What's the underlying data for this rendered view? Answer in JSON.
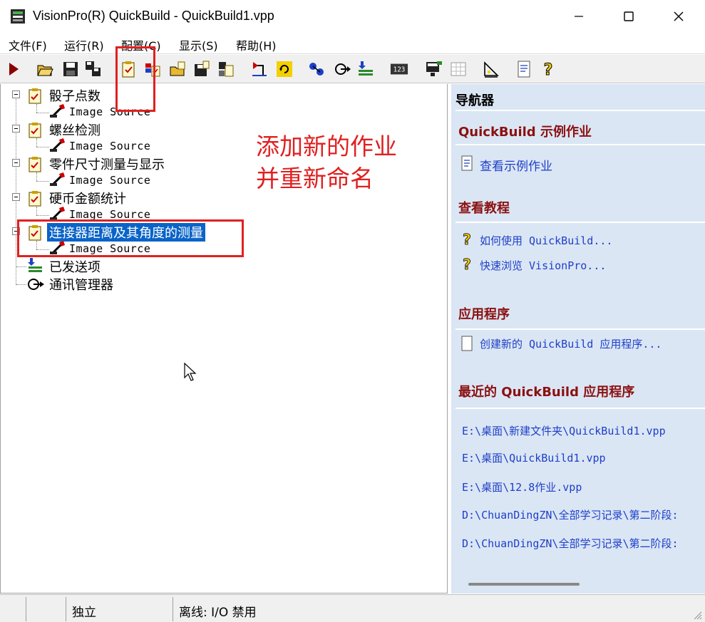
{
  "window": {
    "title": "VisionPro(R) QuickBuild - QuickBuild1.vpp"
  },
  "menu": {
    "items": [
      "文件(F)",
      "运行(R)",
      "配置(C)",
      "显示(S)",
      "帮助(H)"
    ]
  },
  "toolbar": {
    "icons": [
      "run-icon",
      "open-icon",
      "save-icon",
      "save-all-icon",
      "new-job-icon",
      "job-settings-icon",
      "open-job-icon",
      "save-job-icon",
      "job-properties-icon",
      "import-icon",
      "refresh-icon",
      "posted-items-icon",
      "comm-manager-icon",
      "send-icon",
      "counter-icon",
      "terminal-icon",
      "grid-icon",
      "measure-icon",
      "script-icon",
      "help-icon"
    ]
  },
  "tree": {
    "jobs": [
      {
        "name": "骰子点数",
        "child": "Image Source"
      },
      {
        "name": "螺丝检测",
        "child": "Image Source"
      },
      {
        "name": "零件尺寸测量与显示",
        "child": "Image Source"
      },
      {
        "name": "硬币金额统计",
        "child": "Image Source"
      },
      {
        "name": "连接器距离及其角度的测量",
        "child": "Image Source",
        "selected": true
      }
    ],
    "posted_items": "已发送项",
    "comm_manager": "通讯管理器"
  },
  "annotation": {
    "line1": "添加新的作业",
    "line2": "并重新命名",
    "color": "#e02020"
  },
  "navigator": {
    "title": "导航器",
    "sections": {
      "examples": {
        "heading": "QuickBuild 示例作业",
        "link": "查看示例作业"
      },
      "tutorials": {
        "heading": "查看教程",
        "links": [
          "如何使用 QuickBuild...",
          "快速浏览 VisionPro..."
        ]
      },
      "application": {
        "heading": "应用程序",
        "link": "创建新的 QuickBuild 应用程序..."
      },
      "recent": {
        "heading": "最近的 QuickBuild 应用程序",
        "paths": [
          "E:\\桌面\\新建文件夹\\QuickBuild1.vpp",
          "E:\\桌面\\QuickBuild1.vpp",
          "E:\\桌面\\12.8作业.vpp",
          "D:\\ChuanDingZN\\全部学习记录\\第二阶段:",
          "D:\\ChuanDingZN\\全部学习记录\\第二阶段:"
        ]
      }
    }
  },
  "status": {
    "mode": "独立",
    "io": "离线: I/O 禁用"
  },
  "colors": {
    "accent_red": "#8b1010",
    "link_blue": "#1d3fc8",
    "nav_background": "#dbe6f4",
    "selection": "#0a64c8"
  }
}
